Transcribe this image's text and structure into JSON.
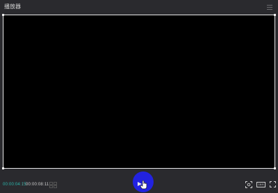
{
  "window": {
    "title": "播放器"
  },
  "player": {
    "current_time": "00:00:04:15",
    "separator": "/",
    "total_time": "00:00:08:11",
    "ratio_label": "16:9"
  },
  "colors": {
    "accent_time": "#2bb7ad",
    "play_button": "#2222e0",
    "background": "#2a2a2e",
    "viewer": "#000000"
  },
  "icons": {
    "menu": "menu-icon",
    "step": "step-frame-icon",
    "play": "play-icon",
    "cursor": "hand-cursor-icon",
    "screenshot": "screenshot-icon",
    "fullscreen": "fullscreen-icon"
  }
}
